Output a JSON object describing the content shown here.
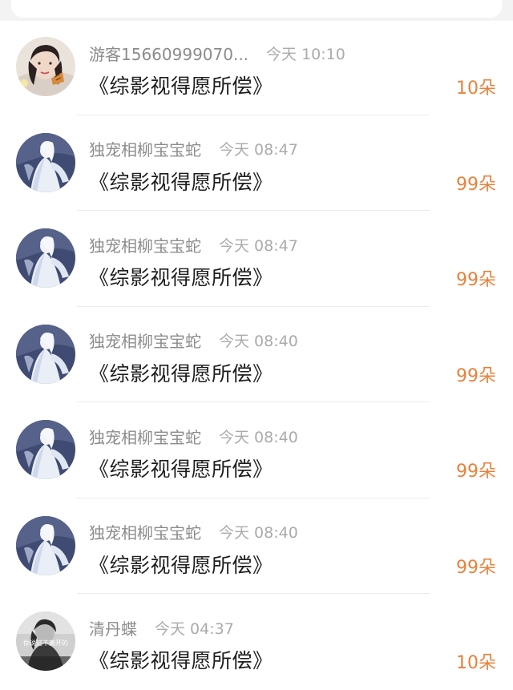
{
  "search": {
    "icon": "search-icon"
  },
  "items": [
    {
      "avatar": "avatar-woman-flowers",
      "name": "游客15660999070...",
      "time": "今天 10:10",
      "title": "《综影视得愿所偿》",
      "flowers": "10朵"
    },
    {
      "avatar": "avatar-white-robed-figure",
      "name": "独宠相柳宝宝蛇",
      "time": "今天 08:47",
      "title": "《综影视得愿所偿》",
      "flowers": "99朵"
    },
    {
      "avatar": "avatar-white-robed-figure",
      "name": "独宠相柳宝宝蛇",
      "time": "今天 08:47",
      "title": "《综影视得愿所偿》",
      "flowers": "99朵"
    },
    {
      "avatar": "avatar-white-robed-figure",
      "name": "独宠相柳宝宝蛇",
      "time": "今天 08:40",
      "title": "《综影视得愿所偿》",
      "flowers": "99朵"
    },
    {
      "avatar": "avatar-white-robed-figure",
      "name": "独宠相柳宝宝蛇",
      "time": "今天 08:40",
      "title": "《综影视得愿所偿》",
      "flowers": "99朵"
    },
    {
      "avatar": "avatar-white-robed-figure",
      "name": "独宠相柳宝宝蛇",
      "time": "今天 08:40",
      "title": "《综影视得愿所偿》",
      "flowers": "99朵"
    },
    {
      "avatar": "avatar-bw-portrait",
      "avatar_caption": "你说过不离开的",
      "name": "清丹蝶",
      "time": "今天 04:37",
      "title": "《综影视得愿所偿》",
      "flowers": "10朵"
    }
  ],
  "colors": {
    "accent_flowers": "#e8813c",
    "name_text": "#8c8c8c",
    "title_text": "#1e1e1e"
  }
}
